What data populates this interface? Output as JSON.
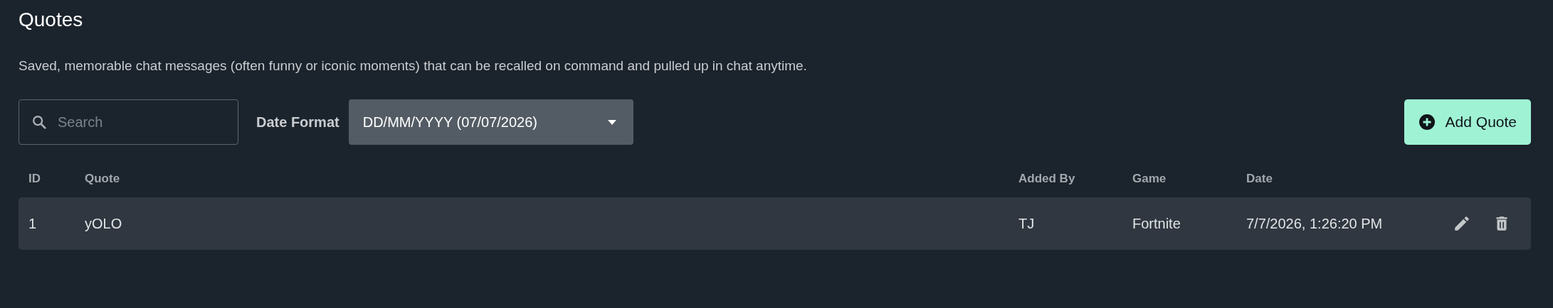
{
  "title": "Quotes",
  "description": "Saved, memorable chat messages (often funny or iconic moments) that can be recalled on command and pulled up in chat anytime.",
  "search": {
    "placeholder": "Search"
  },
  "date_format": {
    "label": "Date Format",
    "value": "DD/MM/YYYY (07/07/2026)"
  },
  "add_button": {
    "label": "Add Quote"
  },
  "table": {
    "columns": [
      "ID",
      "Quote",
      "Added By",
      "Game",
      "Date"
    ],
    "rows": [
      {
        "cells": [
          "1",
          "yOLO",
          "TJ",
          "Fortnite",
          "7/7/2026, 1:26:20 PM"
        ]
      }
    ]
  }
}
